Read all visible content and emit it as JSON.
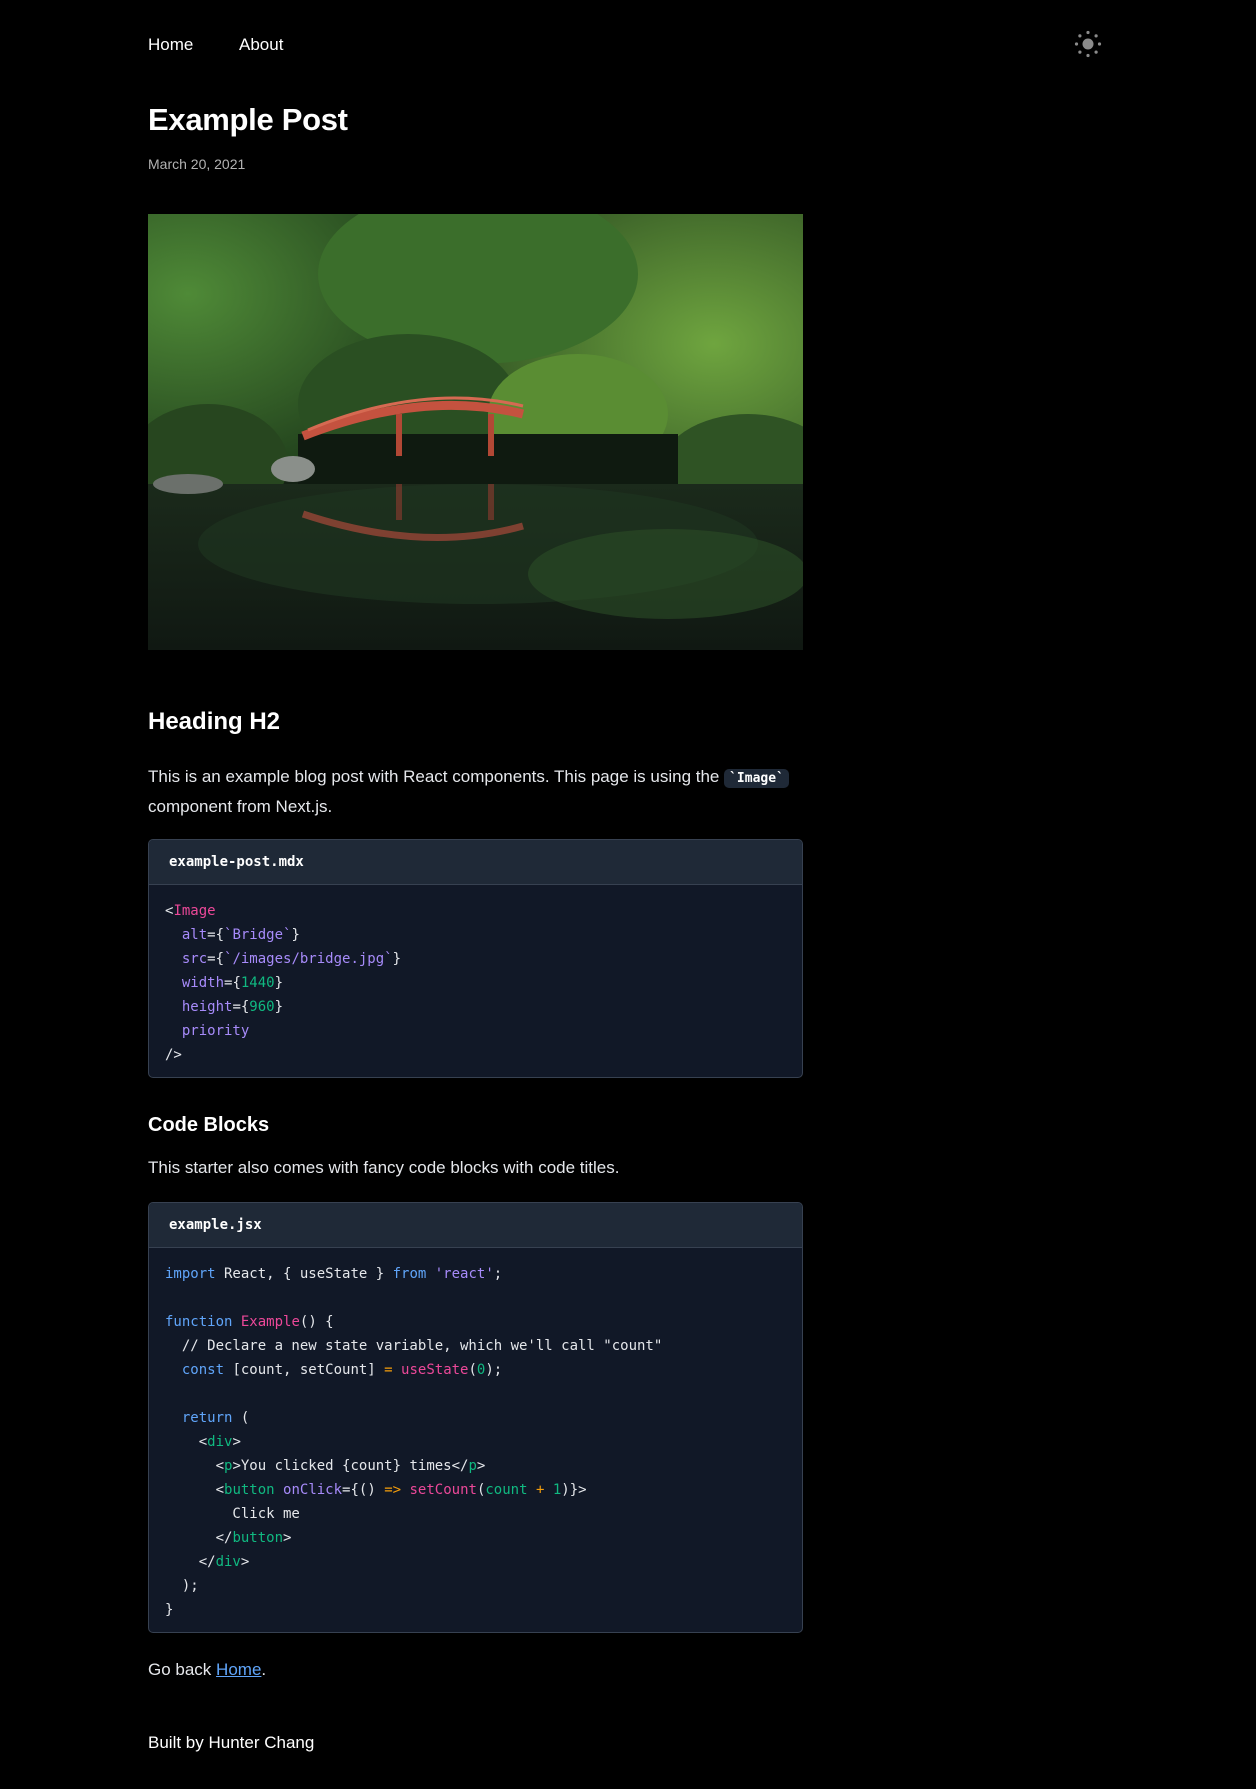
{
  "nav": {
    "home": "Home",
    "about": "About"
  },
  "post": {
    "title": "Example Post",
    "date": "March 20, 2021"
  },
  "section1": {
    "heading": "Heading H2",
    "text_before": "This is an example blog post with React components. This page is using the ",
    "inline_code": "`Image`",
    "text_after": " component from Next.js."
  },
  "codeblock1": {
    "title": "example-post.mdx",
    "lines": [
      [
        [
          "plain",
          "<"
        ],
        [
          "tag",
          "Image"
        ]
      ],
      [
        [
          "plain",
          "  "
        ],
        [
          "attr",
          "alt"
        ],
        [
          "plain",
          "={"
        ],
        [
          "str",
          "`Bridge`"
        ],
        [
          "plain",
          "}"
        ]
      ],
      [
        [
          "plain",
          "  "
        ],
        [
          "attr",
          "src"
        ],
        [
          "plain",
          "={"
        ],
        [
          "str",
          "`/images/bridge.jpg`"
        ],
        [
          "plain",
          "}"
        ]
      ],
      [
        [
          "plain",
          "  "
        ],
        [
          "attr",
          "width"
        ],
        [
          "plain",
          "={"
        ],
        [
          "num",
          "1440"
        ],
        [
          "plain",
          "}"
        ]
      ],
      [
        [
          "plain",
          "  "
        ],
        [
          "attr",
          "height"
        ],
        [
          "plain",
          "={"
        ],
        [
          "num",
          "960"
        ],
        [
          "plain",
          "}"
        ]
      ],
      [
        [
          "plain",
          "  "
        ],
        [
          "attr",
          "priority"
        ]
      ],
      [
        [
          "plain",
          "/>"
        ]
      ]
    ]
  },
  "section2": {
    "heading": "Code Blocks",
    "text": "This starter also comes with fancy code blocks with code titles."
  },
  "codeblock2": {
    "title": "example.jsx",
    "lines": [
      [
        [
          "kw",
          "import"
        ],
        [
          "plain",
          " React, { useState } "
        ],
        [
          "kw",
          "from"
        ],
        [
          "plain",
          " "
        ],
        [
          "str",
          "'react'"
        ],
        [
          "plain",
          ";"
        ]
      ],
      [],
      [
        [
          "kw",
          "function"
        ],
        [
          "plain",
          " "
        ],
        [
          "fn",
          "Example"
        ],
        [
          "plain",
          "() {"
        ]
      ],
      [
        [
          "comment",
          "  // Declare a new state variable, which we'll call \"count\""
        ]
      ],
      [
        [
          "plain",
          "  "
        ],
        [
          "kw",
          "const"
        ],
        [
          "plain",
          " [count, setCount] "
        ],
        [
          "op",
          "="
        ],
        [
          "plain",
          " "
        ],
        [
          "fn",
          "useState"
        ],
        [
          "plain",
          "("
        ],
        [
          "num",
          "0"
        ],
        [
          "plain",
          ");"
        ]
      ],
      [],
      [
        [
          "plain",
          "  "
        ],
        [
          "kw",
          "return"
        ],
        [
          "plain",
          " ("
        ]
      ],
      [
        [
          "plain",
          "    <"
        ],
        [
          "html",
          "div"
        ],
        [
          "plain",
          ">"
        ]
      ],
      [
        [
          "plain",
          "      <"
        ],
        [
          "html",
          "p"
        ],
        [
          "plain",
          ">You clicked {count} times</"
        ],
        [
          "html",
          "p"
        ],
        [
          "plain",
          ">"
        ]
      ],
      [
        [
          "plain",
          "      <"
        ],
        [
          "html",
          "button"
        ],
        [
          "plain",
          " "
        ],
        [
          "attr",
          "onClick"
        ],
        [
          "plain",
          "={() "
        ],
        [
          "op",
          "=>"
        ],
        [
          "plain",
          " "
        ],
        [
          "fn",
          "setCount"
        ],
        [
          "plain",
          "("
        ],
        [
          "html",
          "count"
        ],
        [
          "plain",
          " "
        ],
        [
          "op",
          "+"
        ],
        [
          "plain",
          " "
        ],
        [
          "num",
          "1"
        ],
        [
          "plain",
          ")}>"
        ]
      ],
      [
        [
          "plain",
          "        Click me"
        ]
      ],
      [
        [
          "plain",
          "      </"
        ],
        [
          "html",
          "button"
        ],
        [
          "plain",
          ">"
        ]
      ],
      [
        [
          "plain",
          "    </"
        ],
        [
          "html",
          "div"
        ],
        [
          "plain",
          ">"
        ]
      ],
      [
        [
          "plain",
          "  );"
        ]
      ],
      [
        [
          "plain",
          "}"
        ]
      ]
    ]
  },
  "footer_text": {
    "go_back": "Go back ",
    "home_link": "Home",
    "period": ".",
    "built_by": "Built by Hunter Chang"
  },
  "icons": {
    "theme_toggle": "sun-icon"
  }
}
